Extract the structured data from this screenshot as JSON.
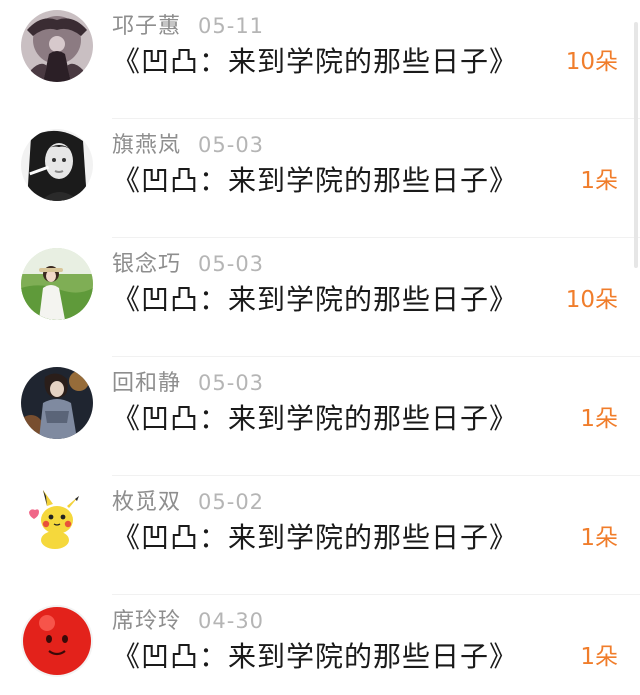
{
  "rows": [
    {
      "name": "邛子蕙",
      "date": "05-11",
      "title": "《凹凸：来到学院的那些日子》",
      "count": "10朵",
      "avatar": "dark-figure-avatar"
    },
    {
      "name": "旗燕岚",
      "date": "05-03",
      "title": "《凹凸：来到学院的那些日子》",
      "count": "1朵",
      "avatar": "grayscale-portrait-avatar"
    },
    {
      "name": "银念巧",
      "date": "05-03",
      "title": "《凹凸：来到学院的那些日子》",
      "count": "10朵",
      "avatar": "field-girl-avatar"
    },
    {
      "name": "回和静",
      "date": "05-03",
      "title": "《凹凸：来到学院的那些日子》",
      "count": "1朵",
      "avatar": "night-figure-avatar"
    },
    {
      "name": "枚觅双",
      "date": "05-02",
      "title": "《凹凸：来到学院的那些日子》",
      "count": "1朵",
      "avatar": "pikachu-avatar"
    },
    {
      "name": "席玲玲",
      "date": "04-30",
      "title": "《凹凸：来到学院的那些日子》",
      "count": "1朵",
      "avatar": "red-ball-avatar"
    }
  ],
  "colors": {
    "count_accent": "#f07d2b",
    "name_gray": "#8e8e8e",
    "date_gray": "#b5b5b5",
    "title_dark": "#1a1a1a"
  }
}
